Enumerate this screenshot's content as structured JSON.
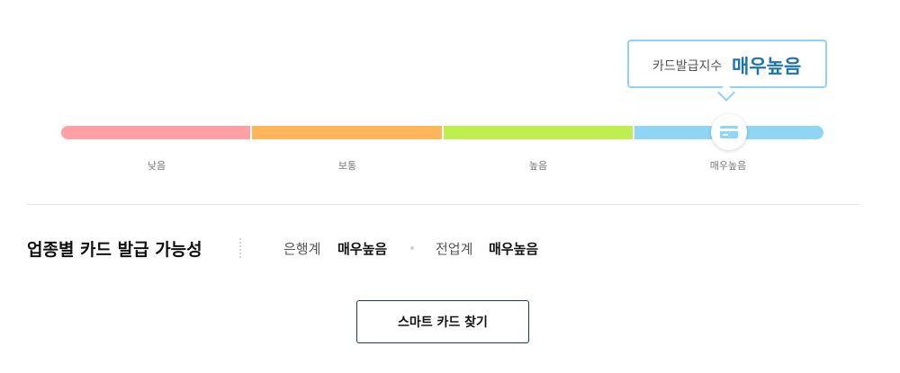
{
  "summary": {
    "label": "카드발급지수",
    "value": "매우높음"
  },
  "gauge": {
    "current_level": 4,
    "levels": [
      {
        "label": "낮음",
        "color": "#ffa0a5"
      },
      {
        "label": "보통",
        "color": "#ffb55a"
      },
      {
        "label": "높음",
        "color": "#bfef4e"
      },
      {
        "label": "매우높음",
        "color": "#8fd6f5"
      }
    ],
    "marker_icon": "credit-card-icon"
  },
  "industry": {
    "title": "업종별 카드 발급 가능성",
    "items": [
      {
        "label": "은행계",
        "value": "매우높음"
      },
      {
        "label": "전업계",
        "value": "매우높음"
      }
    ]
  },
  "cta": {
    "label": "스마트 카드 찾기"
  },
  "colors": {
    "accent": "#1f74a8",
    "tooltip_border": "#8fd3f4",
    "button_border": "#1d3a5f"
  }
}
